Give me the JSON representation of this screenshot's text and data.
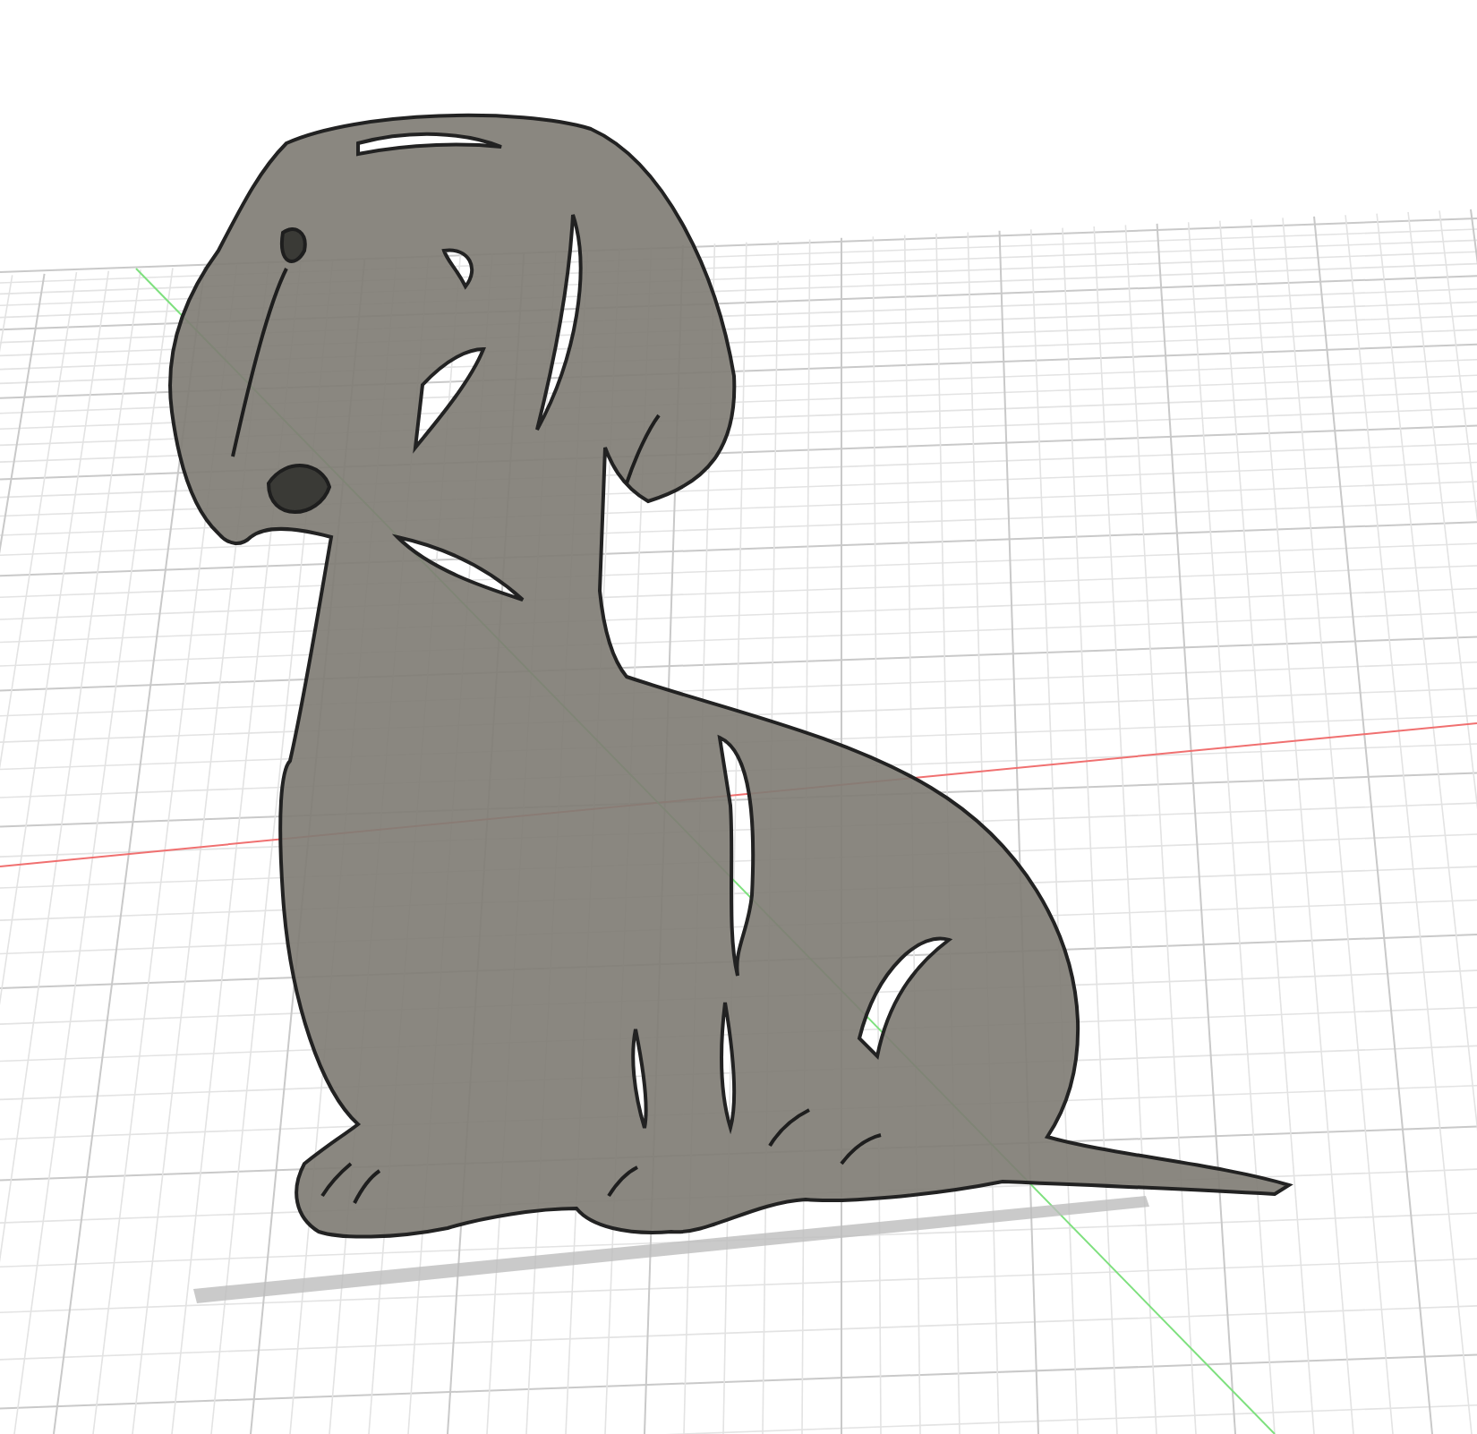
{
  "viewport": {
    "show_grid": true,
    "show_axes": true,
    "model": {
      "kind": "cutout"
    }
  }
}
